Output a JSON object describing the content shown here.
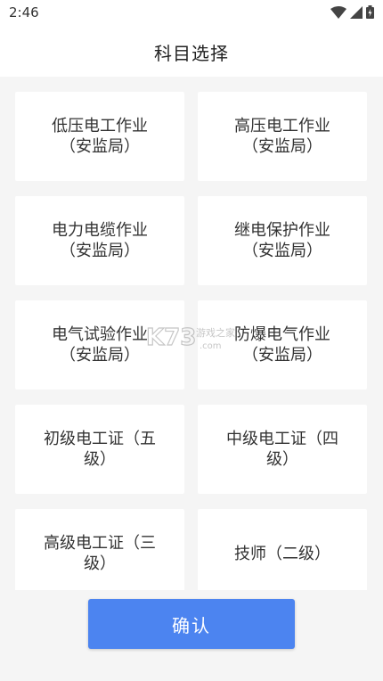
{
  "status_bar": {
    "time": "2:46",
    "icons": [
      "wifi-icon",
      "signal-icon",
      "battery-icon"
    ]
  },
  "header": {
    "title": "科目选择"
  },
  "subjects": [
    {
      "line1": "低压电工作业",
      "line2": "（安监局）"
    },
    {
      "line1": "高压电工作业",
      "line2": "（安监局）"
    },
    {
      "line1": "电力电缆作业",
      "line2": "（安监局）"
    },
    {
      "line1": "继电保护作业",
      "line2": "（安监局）"
    },
    {
      "line1": "电气试验作业",
      "line2": "（安监局）"
    },
    {
      "line1": "防爆电气作业",
      "line2": "（安监局）"
    },
    {
      "line1": "初级电工证（五",
      "line2": "级）"
    },
    {
      "line1": "中级电工证（四",
      "line2": "级）"
    },
    {
      "line1": "高级电工证（三",
      "line2": "级）"
    },
    {
      "line1": "技师（二级）",
      "line2": ""
    }
  ],
  "confirm_button": {
    "label": "确认"
  },
  "colors": {
    "accent": "#4c84f0",
    "background": "#f5f5f5",
    "card": "#ffffff"
  },
  "watermark": {
    "logo": "K73",
    "text": "游戏之家",
    "domain": ".com"
  }
}
